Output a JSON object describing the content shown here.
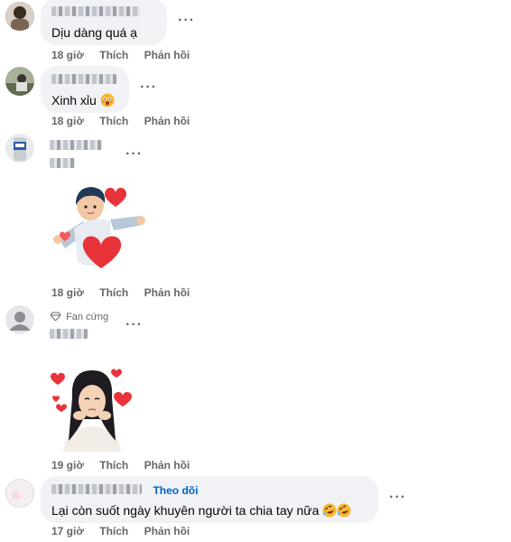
{
  "comments": [
    {
      "text": "Dịu dàng quá ạ",
      "time": "18 giờ",
      "like": "Thích",
      "reply": "Phản hồi"
    },
    {
      "text": "Xinh xỉu",
      "emoji_icon": "astonished-face-icon",
      "time": "18 giờ",
      "like": "Thích",
      "reply": "Phản hồi"
    },
    {
      "sticker": "boy-with-hearts-sticker",
      "time": "18 giờ",
      "like": "Thích",
      "reply": "Phản hồi"
    },
    {
      "badge": "Fan cứng",
      "badge_icon": "diamond-icon",
      "sticker": "girl-with-hearts-sticker",
      "time": "19 giờ",
      "like": "Thích",
      "reply": "Phản hồi"
    },
    {
      "follow": "Theo dõi",
      "text": "Lại còn suốt ngày khuyên người ta chia tay nữa",
      "emoji_icon": "rolling-laughing-face-icon",
      "time": "17 giờ",
      "like": "Thích",
      "reply": "Phản hồi"
    }
  ],
  "more_icon": "more-options-icon",
  "colors": {
    "bubble": "#f0f2f5",
    "meta": "#65676b",
    "link": "#0064d1",
    "heart": "#e8333a"
  }
}
